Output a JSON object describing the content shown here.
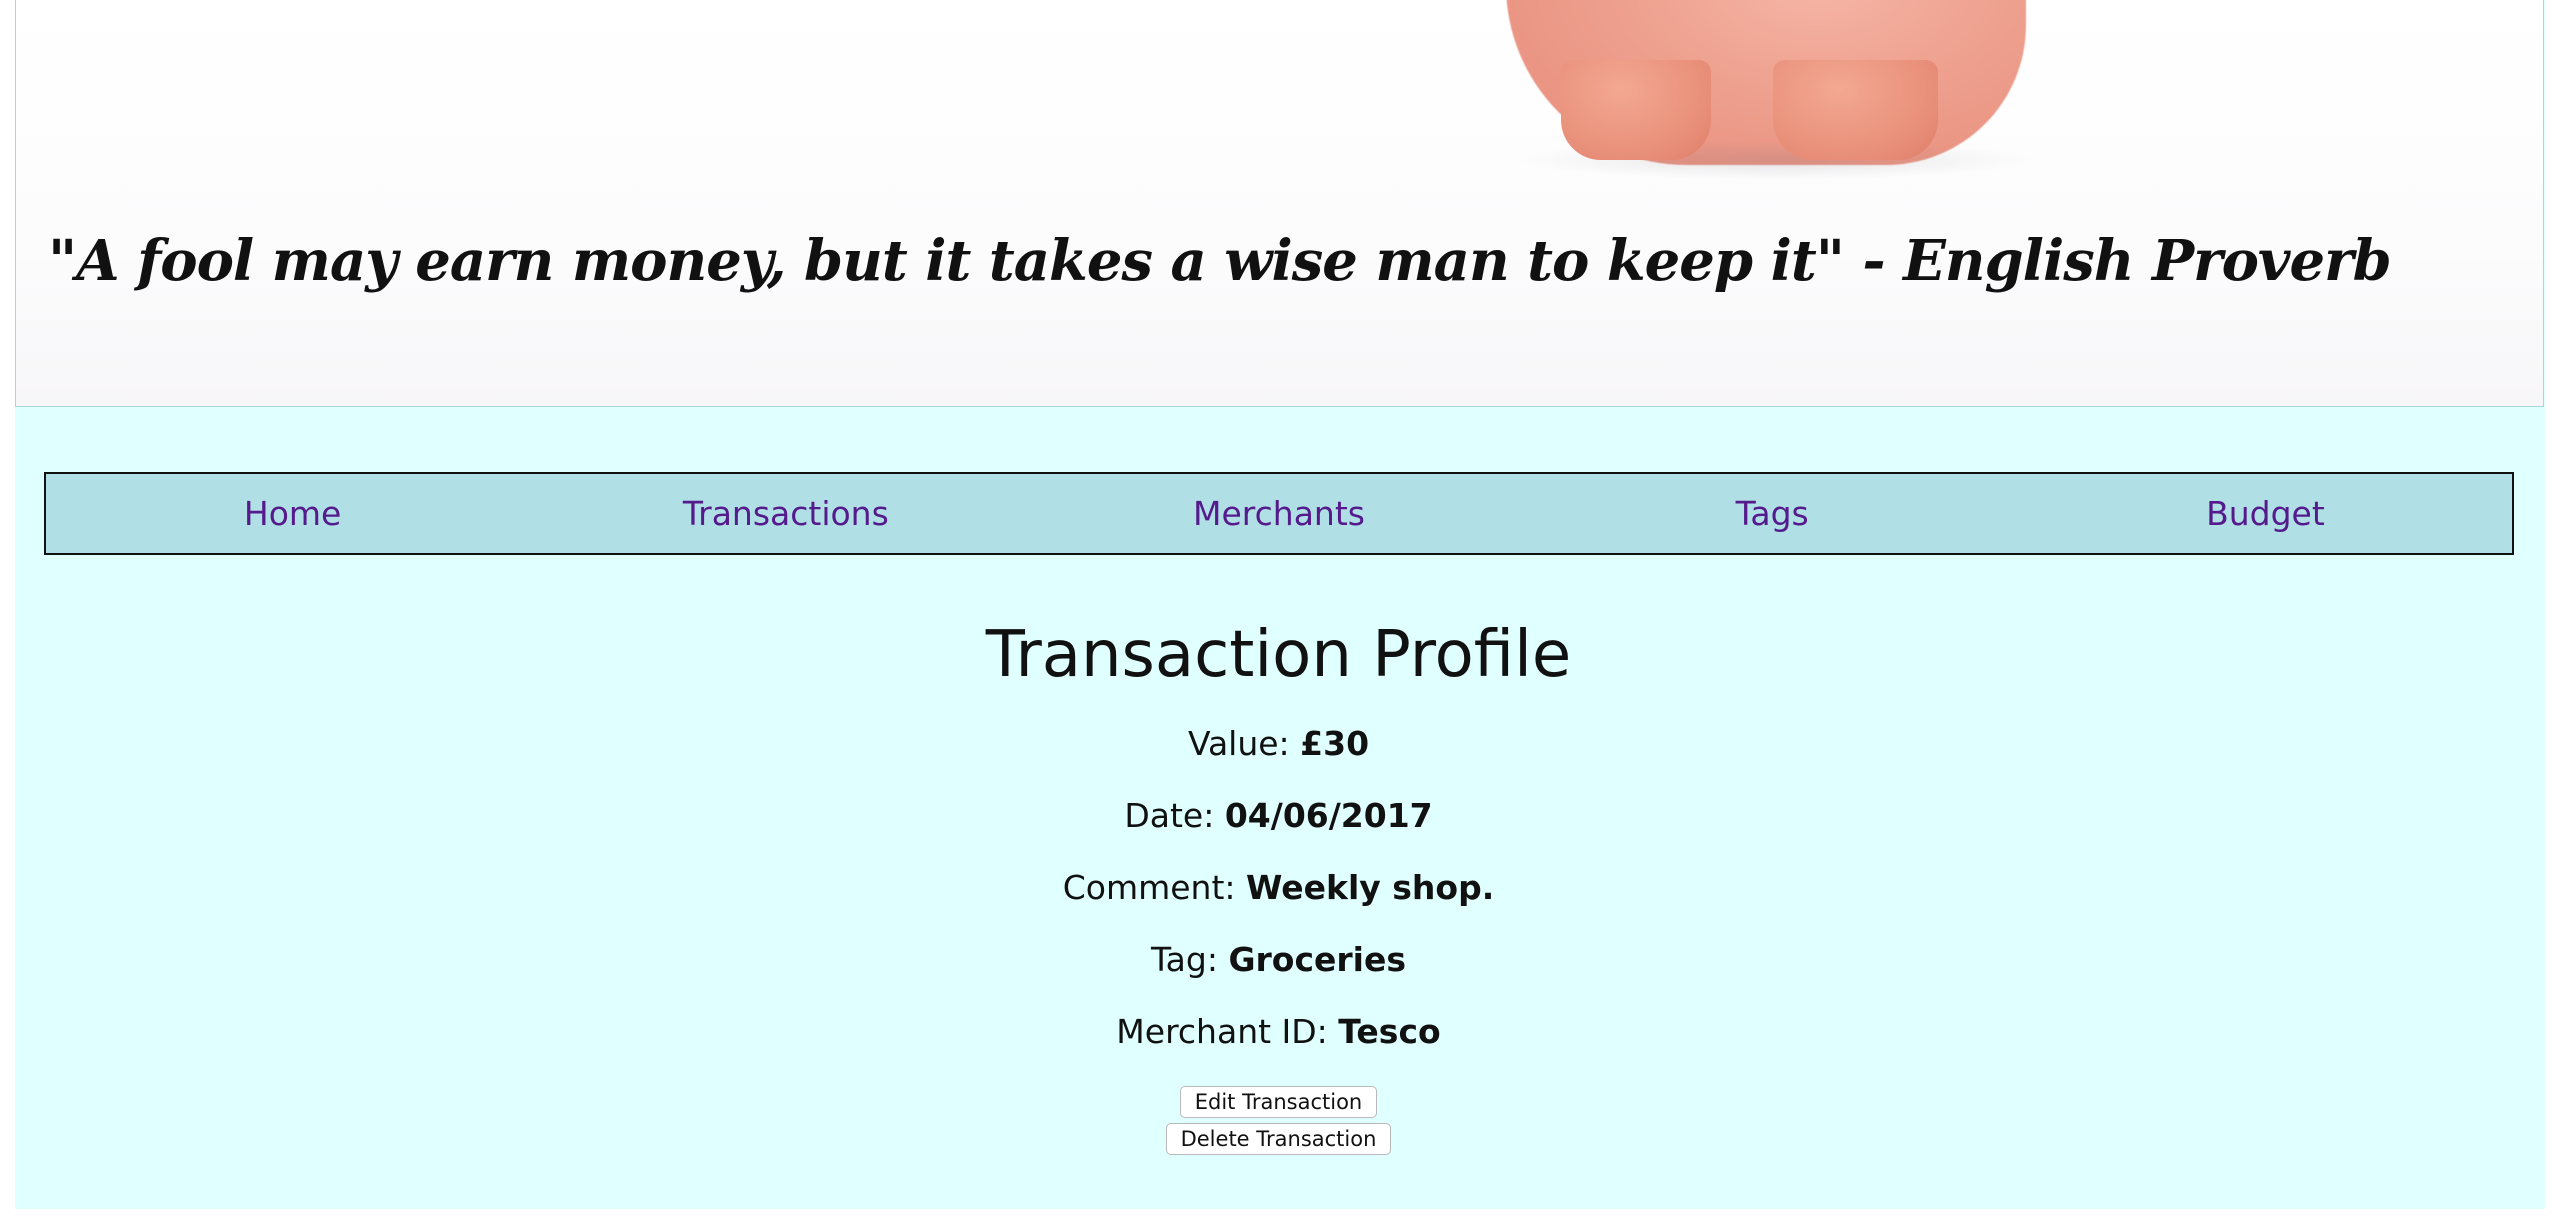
{
  "hero": {
    "quote": "\"A fool may earn money, but it takes a wise man to keep it\" - English Proverb"
  },
  "nav": {
    "items": [
      {
        "label": "Home"
      },
      {
        "label": "Transactions"
      },
      {
        "label": "Merchants"
      },
      {
        "label": "Tags"
      },
      {
        "label": "Budget"
      }
    ]
  },
  "profile": {
    "title": "Transaction Profile",
    "fields": [
      {
        "label": "Value: ",
        "value": "£30"
      },
      {
        "label": "Date: ",
        "value": "04/06/2017"
      },
      {
        "label": "Comment: ",
        "value": "Weekly shop."
      },
      {
        "label": "Tag: ",
        "value": "Groceries"
      },
      {
        "label": "Merchant ID: ",
        "value": "Tesco"
      }
    ],
    "edit_label": "Edit Transaction",
    "delete_label": "Delete Transaction"
  },
  "colors": {
    "page_bg": "#e0ffff",
    "nav_bg": "#b0e0e6",
    "link": "#551a8b"
  }
}
